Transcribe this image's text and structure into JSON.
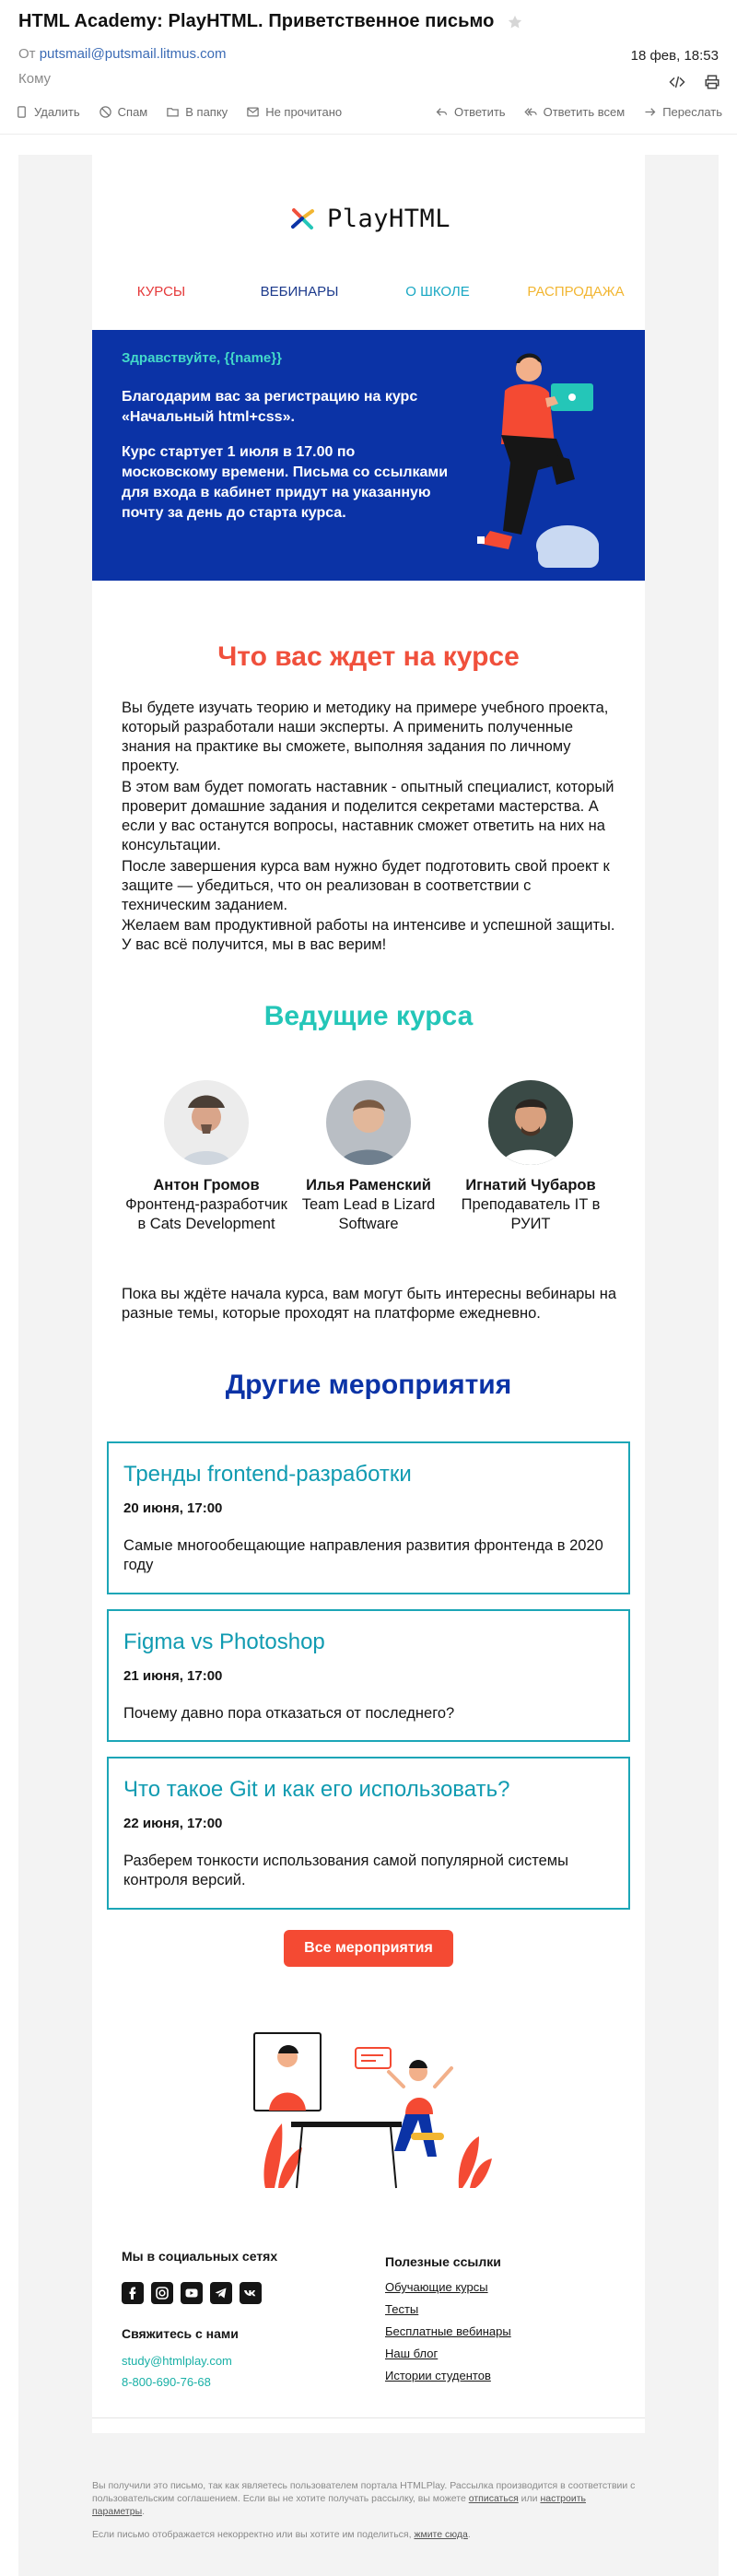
{
  "mail": {
    "subject": "HTML Academy: PlayHTML. Приветственное письмо",
    "from_label": "От",
    "from_address": "putsmail@putsmail.litmus.com",
    "to_label": "Кому",
    "date": "18 фев, 18:53",
    "toolbar": {
      "delete": "Удалить",
      "spam": "Спам",
      "folder": "В папку",
      "unread": "Не прочитано",
      "reply": "Ответить",
      "reply_all": "Ответить всем",
      "forward": "Переслать"
    },
    "icons": [
      "star-icon",
      "code-icon",
      "print-icon",
      "trash-icon",
      "spam-icon",
      "folder-icon",
      "mail-icon",
      "reply-icon",
      "reply-all-icon",
      "forward-icon"
    ]
  },
  "email": {
    "logo_text": "PlayHTML",
    "nav": [
      {
        "label": "КУРСЫ",
        "color": "#e5393a"
      },
      {
        "label": "ВЕБИНАРЫ",
        "color": "#1c3a8c"
      },
      {
        "label": "О ШКОЛЕ",
        "color": "#17a7c3"
      },
      {
        "label": "РАСПРОДАЖА",
        "color": "#f2b632"
      }
    ],
    "hero": {
      "greeting": "Здравствуйте, {{name}}",
      "p1": "Благодарим вас за регистрацию на курс «Начальный html+css».",
      "p2": "Курс стартует 1 июля в 17.00 по московскому времени. Письма со ссылками для входа в кабинет придут на указанную почту за день до старта курса.",
      "bg": "#0b33a6"
    },
    "course": {
      "title": "Что вас ждет на курсе",
      "title_color": "#f0503c",
      "p1": "Вы будете изучать теорию и методику на примере учебного проекта, который разработали наши эксперты. А применить полученные знания на практике вы сможете, выполняя задания по личному проекту.",
      "p2": "В этом вам будет помогать наставник - опытный специалист, который проверит домашние задания и поделится секретами мастерства. А если у вас останутся вопросы, наставник сможет ответить на них на консультации.",
      "p3": "После завершения курса вам нужно будет подготовить свой проект к защите — убедиться, что он реализован в соответствии с техническим заданием.",
      "p4": "Желаем вам продуктивной работы на интенсиве и успешной защиты. У вас всё получится, мы в вас верим!"
    },
    "teachers_title": "Ведущие курса",
    "teachers_title_color": "#24c6b8",
    "teachers": [
      {
        "name": "Антон Громов",
        "role": "Фронтенд-разработчик в Cats Development"
      },
      {
        "name": "Илья Раменский",
        "role": "Team Lead в Lizard Software"
      },
      {
        "name": "Игнатий Чубаров",
        "role": "Преподаватель IT в РУИТ"
      }
    ],
    "webinars_note": "Пока вы ждёте начала курса, вам могут быть интересны вебинары на разные темы, которые проходят на платформе ежедневно.",
    "events_title": "Другие мероприятия",
    "events_title_color": "#0b33a6",
    "events": [
      {
        "title": "Тренды frontend-разработки",
        "date": "20 июня, 17:00",
        "desc": "Самые многообещающие направления развития фронтенда в 2020 году"
      },
      {
        "title": "Figma vs Photoshop",
        "date": "21 июня, 17:00",
        "desc": "Почему давно пора отказаться от последнего?"
      },
      {
        "title": "Что такое Git и как его использовать?",
        "date": "22 июня, 17:00",
        "desc": "Разберем тонкости использования самой популярной системы контроля версий."
      }
    ],
    "all_events_button": "Все мероприятия",
    "footer": {
      "social_title": "Мы в социальных сетях",
      "social_icons": [
        "facebook-icon",
        "instagram-icon",
        "youtube-icon",
        "telegram-icon",
        "vk-icon"
      ],
      "contact_title": "Свяжитесь с нами",
      "email": "study@htmlplay.com",
      "phone": "8-800-690-76-68",
      "links_title": "Полезные ссылки",
      "links": [
        "Обучающие курсы",
        "Тесты",
        "Бесплатные вебинары",
        "Наш блог",
        "Истории студентов"
      ]
    },
    "legal": {
      "text1": "Вы получили это письмо, так как являетесь пользователем портала HTMLPlay. Рассылка производится в соответствии с пользовательским соглашением. Если вы не хотите получать рассылку, вы можете ",
      "unsubscribe": "отписаться",
      "or": " или ",
      "settings": "настроить параметры",
      "dot": ".",
      "text2": "Если письмо отображается некорректно или вы хотите им поделиться, ",
      "view_here": "жмите сюда",
      "dot2": "."
    }
  }
}
